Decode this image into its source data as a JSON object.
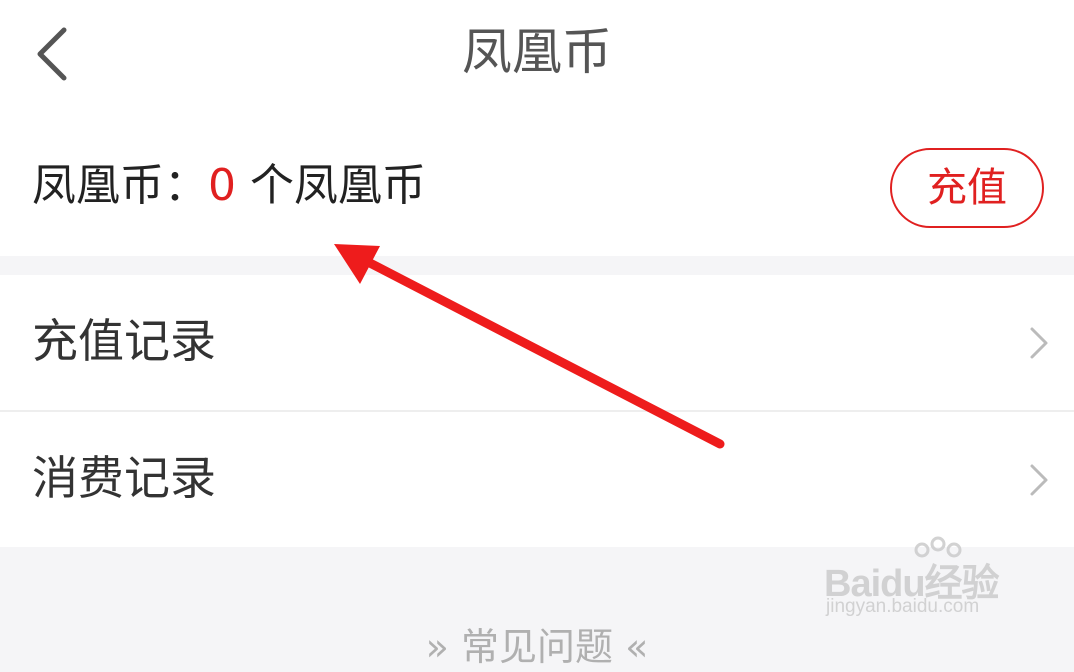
{
  "header": {
    "title": "凤凰币",
    "back_icon": "chevron-left-icon"
  },
  "balance": {
    "label": "凤凰币：",
    "amount": "0",
    "unit": "个凤凰币",
    "recharge_label": "充值",
    "accent_color": "#e02020"
  },
  "menu": {
    "items": [
      {
        "label": "充值记录",
        "icon": "chevron-right-icon"
      },
      {
        "label": "消费记录",
        "icon": "chevron-right-icon"
      }
    ]
  },
  "faq": {
    "title": "常见问题"
  },
  "annotation": {
    "color": "#ee1c1c"
  },
  "watermark": {
    "logo": "Baidu经验",
    "url": "jingyan.baidu.com"
  }
}
